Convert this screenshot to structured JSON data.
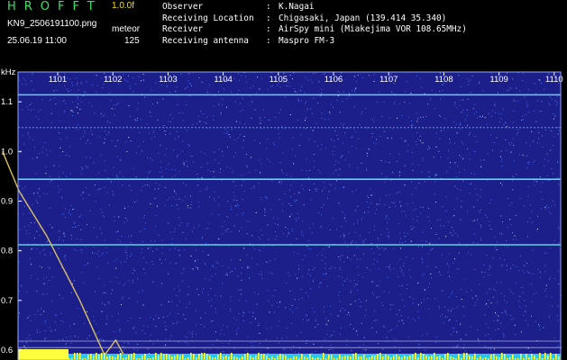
{
  "header": {
    "app_title": "HROFFT",
    "version": "1.0.0f",
    "filename": "KN9_2506191100.png",
    "mode": "meteor",
    "datetime": "25.06.19 11:00",
    "count": "125",
    "info": [
      {
        "label": "Observer",
        "value": "K.Nagai"
      },
      {
        "label": "Receiving Location",
        "value": "Chigasaki, Japan (139.414 35.340)"
      },
      {
        "label": "Receiver",
        "value": "AirSpy mini (Miakejima VOR 108.65MHz)"
      },
      {
        "label": "Receiving antenna",
        "value": "Maspro FM-3"
      }
    ]
  },
  "spectrogram": {
    "freq_unit": "kHz",
    "time_ticks": [
      "1101",
      "1102",
      "1103",
      "1104",
      "1105",
      "1106",
      "1107",
      "1108",
      "1109",
      "1110"
    ],
    "freq_ticks": [
      "1.1",
      "1.0",
      "0.9",
      "0.8",
      "0.7",
      "0.6"
    ],
    "freq_range_khz": [
      0.58,
      1.16
    ],
    "carrier_lines_khz": [
      1.114,
      1.048,
      0.944,
      0.812
    ],
    "meteor_trace": [
      [
        1100.0,
        1.0
      ],
      [
        1100.3,
        0.92
      ],
      [
        1100.8,
        0.83
      ],
      [
        1101.4,
        0.7
      ],
      [
        1101.85,
        0.59
      ],
      [
        1102.05,
        0.62
      ],
      [
        1102.25,
        0.58
      ]
    ],
    "colors": {
      "background": "#1c1e8a",
      "noise": "#4c6cf0",
      "carrier": "#5fe0e8",
      "trace": "#f0d060",
      "bottom_bar": "#ffff40"
    }
  }
}
